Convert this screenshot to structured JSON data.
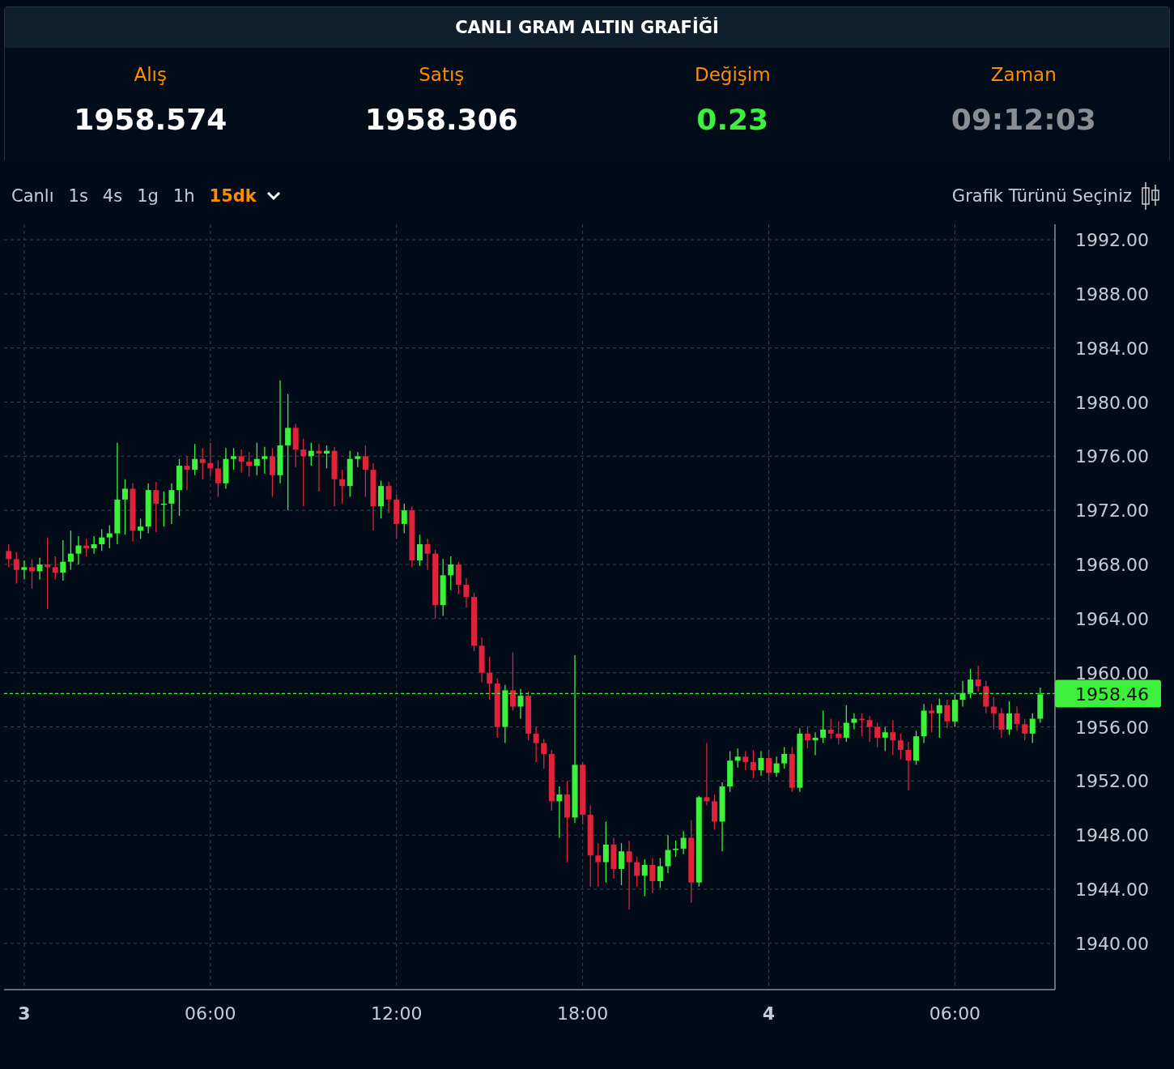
{
  "title": "CANLI GRAM ALTIN GRAFİĞİ",
  "stats": [
    {
      "label": "Alış",
      "value": "1958.574",
      "kind": "price"
    },
    {
      "label": "Satış",
      "value": "1958.306",
      "kind": "price"
    },
    {
      "label": "Değişim",
      "value": "0.23",
      "kind": "change"
    },
    {
      "label": "Zaman",
      "value": "09:12:03",
      "kind": "time"
    }
  ],
  "intervals": [
    {
      "label": "Canlı",
      "selected": false
    },
    {
      "label": "1s",
      "selected": false
    },
    {
      "label": "4s",
      "selected": false
    },
    {
      "label": "1g",
      "selected": false
    },
    {
      "label": "1h",
      "selected": false
    },
    {
      "label": "15dk",
      "selected": true
    }
  ],
  "chart_type_label": "Grafik Türünü Seçiniz",
  "x_axis": [
    {
      "kind": "day"
    },
    {
      "kind": "time"
    },
    {
      "kind": "time"
    },
    {
      "kind": "time"
    },
    {
      "kind": "day"
    },
    {
      "kind": "time"
    }
  ],
  "chart_data": {
    "type": "candlestick",
    "categories": [
      null,
      null,
      "3",
      null,
      null,
      null,
      null,
      null,
      null,
      null,
      null,
      null,
      null,
      null,
      null,
      null,
      null,
      null,
      null,
      null,
      null,
      null,
      null,
      null,
      null,
      null,
      "06:00",
      null,
      null,
      null,
      null,
      null,
      null,
      null,
      null,
      null,
      null,
      null,
      null,
      null,
      null,
      null,
      null,
      null,
      null,
      null,
      null,
      null,
      null,
      null,
      "12:00",
      null,
      null,
      null,
      null,
      null,
      null,
      null,
      null,
      null,
      null,
      null,
      null,
      null,
      null,
      null,
      null,
      null,
      null,
      null,
      null,
      null,
      null,
      null,
      "18:00",
      null,
      null,
      null,
      null,
      null,
      null,
      null,
      null,
      null,
      null,
      null,
      null,
      null,
      null,
      null,
      null,
      null,
      null,
      null,
      null,
      null,
      null,
      null,
      "4",
      null,
      null,
      null,
      null,
      null,
      null,
      null,
      null,
      null,
      null,
      null,
      null,
      null,
      null,
      null,
      null,
      null,
      null,
      null,
      null,
      null,
      null,
      null,
      "06:00",
      null,
      null,
      null,
      null,
      null,
      null,
      null,
      null,
      null,
      null,
      null
    ],
    "ohlc": [
      [
        1969.0,
        1969.5,
        1967.8,
        1968.4
      ],
      [
        1968.4,
        1968.9,
        1966.6,
        1967.6
      ],
      [
        1967.6,
        1968.3,
        1966.9,
        1967.8
      ],
      [
        1967.8,
        1968.4,
        1966.2,
        1967.5
      ],
      [
        1967.5,
        1968.5,
        1966.9,
        1968.0
      ],
      [
        1968.0,
        1970.0,
        1964.7,
        1967.8
      ],
      [
        1967.8,
        1968.6,
        1966.9,
        1967.4
      ],
      [
        1967.4,
        1969.8,
        1966.8,
        1968.2
      ],
      [
        1968.2,
        1970.5,
        1967.6,
        1968.8
      ],
      [
        1968.8,
        1970.1,
        1968.0,
        1969.4
      ],
      [
        1969.4,
        1969.9,
        1968.6,
        1969.2
      ],
      [
        1969.2,
        1970.1,
        1968.8,
        1969.5
      ],
      [
        1969.5,
        1970.6,
        1969.0,
        1970.0
      ],
      [
        1970.0,
        1970.9,
        1969.2,
        1970.3
      ],
      [
        1970.3,
        1977.0,
        1969.5,
        1972.8
      ],
      [
        1972.8,
        1974.3,
        1970.2,
        1973.6
      ],
      [
        1973.6,
        1974.0,
        1969.7,
        1970.5
      ],
      [
        1970.5,
        1971.4,
        1969.9,
        1970.8
      ],
      [
        1970.8,
        1974.0,
        1970.3,
        1973.5
      ],
      [
        1973.5,
        1974.1,
        1970.4,
        1972.5
      ],
      [
        1972.5,
        1973.4,
        1970.8,
        1972.5
      ],
      [
        1972.5,
        1974.0,
        1971.0,
        1973.5
      ],
      [
        1973.5,
        1975.8,
        1971.6,
        1975.3
      ],
      [
        1975.3,
        1976.0,
        1973.5,
        1975.0
      ],
      [
        1975.0,
        1976.9,
        1974.6,
        1975.8
      ],
      [
        1975.8,
        1976.6,
        1974.3,
        1975.5
      ],
      [
        1975.5,
        1977.0,
        1974.5,
        1975.1
      ],
      [
        1975.1,
        1975.7,
        1973.0,
        1974.0
      ],
      [
        1974.0,
        1976.6,
        1973.6,
        1975.8
      ],
      [
        1975.8,
        1976.6,
        1975.0,
        1976.0
      ],
      [
        1976.0,
        1976.5,
        1974.8,
        1975.6
      ],
      [
        1975.6,
        1976.3,
        1974.5,
        1975.3
      ],
      [
        1975.3,
        1977.0,
        1974.6,
        1975.8
      ],
      [
        1975.8,
        1976.7,
        1974.7,
        1976.0
      ],
      [
        1976.0,
        1976.6,
        1973.0,
        1974.6
      ],
      [
        1974.6,
        1981.6,
        1974.0,
        1976.8
      ],
      [
        1976.8,
        1980.6,
        1972.0,
        1978.1
      ],
      [
        1978.1,
        1978.4,
        1975.2,
        1976.5
      ],
      [
        1976.5,
        1977.3,
        1972.3,
        1976.0
      ],
      [
        1976.0,
        1977.0,
        1975.3,
        1976.4
      ],
      [
        1976.4,
        1976.9,
        1973.4,
        1976.2
      ],
      [
        1976.2,
        1976.8,
        1975.1,
        1976.4
      ],
      [
        1976.4,
        1976.7,
        1972.3,
        1974.3
      ],
      [
        1974.3,
        1975.0,
        1972.5,
        1973.8
      ],
      [
        1973.8,
        1976.4,
        1973.0,
        1975.8
      ],
      [
        1975.8,
        1976.3,
        1975.2,
        1976.0
      ],
      [
        1976.0,
        1976.8,
        1973.0,
        1975.0
      ],
      [
        1975.0,
        1975.5,
        1970.5,
        1972.3
      ],
      [
        1972.3,
        1974.2,
        1971.4,
        1973.8
      ],
      [
        1973.8,
        1974.1,
        1971.8,
        1972.8
      ],
      [
        1972.8,
        1973.2,
        1969.9,
        1971.0
      ],
      [
        1971.0,
        1972.5,
        1970.3,
        1972.0
      ],
      [
        1972.0,
        1972.3,
        1967.8,
        1968.3
      ],
      [
        1968.3,
        1970.2,
        1967.9,
        1969.5
      ],
      [
        1969.5,
        1969.9,
        1967.6,
        1968.8
      ],
      [
        1968.8,
        1969.1,
        1964.0,
        1965.0
      ],
      [
        1965.0,
        1968.4,
        1964.2,
        1967.2
      ],
      [
        1967.2,
        1968.6,
        1966.1,
        1968.0
      ],
      [
        1968.0,
        1968.2,
        1965.8,
        1966.5
      ],
      [
        1966.5,
        1967.0,
        1964.8,
        1965.6
      ],
      [
        1965.6,
        1965.9,
        1961.6,
        1962.0
      ],
      [
        1962.0,
        1962.6,
        1959.3,
        1960.0
      ],
      [
        1960.0,
        1961.2,
        1958.0,
        1959.2
      ],
      [
        1959.2,
        1959.6,
        1955.2,
        1956.0
      ],
      [
        1956.0,
        1959.1,
        1954.8,
        1958.7
      ],
      [
        1958.7,
        1961.5,
        1957.2,
        1957.5
      ],
      [
        1957.5,
        1958.8,
        1956.6,
        1958.3
      ],
      [
        1958.3,
        1958.6,
        1955.0,
        1955.5
      ],
      [
        1955.5,
        1956.0,
        1953.4,
        1954.8
      ],
      [
        1954.8,
        1955.1,
        1952.9,
        1954.0
      ],
      [
        1954.0,
        1954.3,
        1949.8,
        1950.5
      ],
      [
        1950.5,
        1951.6,
        1947.8,
        1951.0
      ],
      [
        1951.0,
        1952.0,
        1946.0,
        1949.3
      ],
      [
        1949.3,
        1961.3,
        1948.9,
        1953.2
      ],
      [
        1953.2,
        1953.4,
        1948.8,
        1949.5
      ],
      [
        1949.5,
        1950.2,
        1944.2,
        1946.5
      ],
      [
        1946.5,
        1947.4,
        1944.2,
        1946.0
      ],
      [
        1946.0,
        1949.0,
        1944.5,
        1947.3
      ],
      [
        1947.3,
        1947.8,
        1944.8,
        1945.5
      ],
      [
        1945.5,
        1947.4,
        1944.3,
        1946.8
      ],
      [
        1946.8,
        1947.6,
        1942.5,
        1946.0
      ],
      [
        1946.0,
        1946.4,
        1944.2,
        1945.0
      ],
      [
        1945.0,
        1946.2,
        1943.5,
        1945.8
      ],
      [
        1945.8,
        1946.3,
        1943.7,
        1944.6
      ],
      [
        1944.6,
        1946.3,
        1944.1,
        1945.7
      ],
      [
        1945.7,
        1948.0,
        1945.2,
        1946.9
      ],
      [
        1946.9,
        1947.6,
        1946.4,
        1947.0
      ],
      [
        1947.0,
        1948.3,
        1946.6,
        1947.8
      ],
      [
        1947.8,
        1949.1,
        1943.0,
        1944.5
      ],
      [
        1944.5,
        1950.9,
        1944.2,
        1950.8
      ],
      [
        1950.8,
        1954.8,
        1950.2,
        1950.5
      ],
      [
        1950.5,
        1951.0,
        1948.4,
        1949.0
      ],
      [
        1949.0,
        1951.9,
        1946.8,
        1951.6
      ],
      [
        1951.6,
        1954.2,
        1951.2,
        1953.5
      ],
      [
        1953.5,
        1954.4,
        1953.0,
        1953.8
      ],
      [
        1953.8,
        1954.2,
        1952.8,
        1953.4
      ],
      [
        1953.4,
        1954.3,
        1952.2,
        1952.8
      ],
      [
        1952.8,
        1954.2,
        1952.4,
        1953.7
      ],
      [
        1953.7,
        1954.3,
        1952.0,
        1952.6
      ],
      [
        1952.6,
        1953.8,
        1952.3,
        1953.3
      ],
      [
        1953.3,
        1954.5,
        1952.9,
        1954.0
      ],
      [
        1954.0,
        1954.5,
        1951.2,
        1951.5
      ],
      [
        1951.5,
        1955.9,
        1951.2,
        1955.5
      ],
      [
        1955.5,
        1956.0,
        1954.4,
        1955.0
      ],
      [
        1955.0,
        1955.6,
        1953.9,
        1955.2
      ],
      [
        1955.2,
        1957.2,
        1954.8,
        1955.8
      ],
      [
        1955.8,
        1956.6,
        1955.1,
        1955.5
      ],
      [
        1955.5,
        1956.4,
        1954.7,
        1955.2
      ],
      [
        1955.2,
        1957.6,
        1954.9,
        1956.3
      ],
      [
        1956.3,
        1957.0,
        1955.8,
        1956.6
      ],
      [
        1956.6,
        1957.0,
        1955.3,
        1956.5
      ],
      [
        1956.5,
        1956.8,
        1954.9,
        1956.0
      ],
      [
        1956.0,
        1956.3,
        1954.5,
        1955.2
      ],
      [
        1955.2,
        1956.0,
        1954.2,
        1955.6
      ],
      [
        1955.6,
        1956.5,
        1953.9,
        1955.0
      ],
      [
        1955.0,
        1955.5,
        1953.6,
        1954.3
      ],
      [
        1954.3,
        1954.9,
        1951.3,
        1953.5
      ],
      [
        1953.5,
        1955.7,
        1953.2,
        1955.3
      ],
      [
        1955.3,
        1957.7,
        1954.8,
        1957.2
      ],
      [
        1957.2,
        1957.7,
        1955.6,
        1957.0
      ],
      [
        1957.0,
        1958.1,
        1955.2,
        1957.6
      ],
      [
        1957.6,
        1958.0,
        1955.9,
        1956.4
      ],
      [
        1956.4,
        1958.4,
        1956.0,
        1958.0
      ],
      [
        1958.0,
        1959.4,
        1957.5,
        1958.5
      ],
      [
        1958.5,
        1960.3,
        1958.1,
        1959.5
      ],
      [
        1959.5,
        1960.5,
        1958.6,
        1959.0
      ],
      [
        1959.0,
        1959.4,
        1957.0,
        1957.5
      ],
      [
        1957.5,
        1958.2,
        1955.8,
        1957.0
      ],
      [
        1957.0,
        1957.4,
        1955.2,
        1955.8
      ],
      [
        1955.8,
        1957.9,
        1955.4,
        1957.0
      ],
      [
        1957.0,
        1957.5,
        1955.7,
        1956.2
      ],
      [
        1956.2,
        1956.6,
        1955.0,
        1955.5
      ],
      [
        1955.5,
        1957.0,
        1954.8,
        1956.6
      ],
      [
        1956.6,
        1958.9,
        1956.3,
        1958.4
      ]
    ],
    "ylim": [
      1936.58,
      1993.14
    ],
    "grid": true,
    "ref_lines": [
      {
        "axis": "y",
        "value": 1958.46,
        "label": "1958.46",
        "color": "#3cf03c"
      }
    ],
    "yticks": [
      {
        "value": 1992,
        "label": "1992.00"
      },
      {
        "value": 1988,
        "label": "1988.00"
      },
      {
        "value": 1984,
        "label": "1984.00"
      },
      {
        "value": 1980,
        "label": "1980.00"
      },
      {
        "value": 1976,
        "label": "1976.00"
      },
      {
        "value": 1972,
        "label": "1972.00"
      },
      {
        "value": 1968,
        "label": "1968.00"
      },
      {
        "value": 1964,
        "label": "1964.00"
      },
      {
        "value": 1960,
        "label": "1960.00"
      },
      {
        "value": 1956,
        "label": "1956.00"
      },
      {
        "value": 1952,
        "label": "1952.00"
      },
      {
        "value": 1948,
        "label": "1948.00"
      },
      {
        "value": 1944,
        "label": "1944.00"
      },
      {
        "value": 1940,
        "label": "1940.00"
      }
    ]
  }
}
